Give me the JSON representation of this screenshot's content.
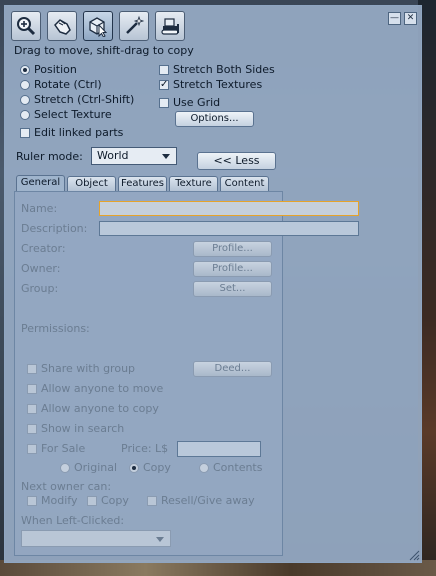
{
  "toolbar": {
    "tools": [
      {
        "name": "zoom",
        "icon": "magnifier-plus-icon"
      },
      {
        "name": "grab",
        "icon": "hand-icon"
      },
      {
        "name": "edit",
        "icon": "cube-cursor-icon"
      },
      {
        "name": "create",
        "icon": "magic-wand-icon"
      },
      {
        "name": "land",
        "icon": "bulldozer-icon"
      }
    ],
    "hint": "Drag to move, shift-drag to copy"
  },
  "window_buttons": {
    "minimize": "—",
    "close": "✕"
  },
  "edit_modes": [
    {
      "label": "Position",
      "selected": true
    },
    {
      "label": "Rotate (Ctrl)",
      "selected": false
    },
    {
      "label": "Stretch (Ctrl-Shift)",
      "selected": false
    },
    {
      "label": "Select Texture",
      "selected": false
    }
  ],
  "options": {
    "stretch_both_sides": {
      "label": "Stretch Both Sides",
      "checked": false
    },
    "stretch_textures": {
      "label": "Stretch Textures",
      "checked": true
    },
    "use_grid": {
      "label": "Use Grid",
      "checked": false
    },
    "options_button": "Options...",
    "edit_linked_parts": {
      "label": "Edit linked parts",
      "checked": false
    }
  },
  "ruler": {
    "label": "Ruler mode:",
    "value": "World"
  },
  "less_button": "<< Less",
  "tabs": [
    "General",
    "Object",
    "Features",
    "Texture",
    "Content"
  ],
  "active_tab": "General",
  "general": {
    "name_label": "Name:",
    "name_value": "",
    "description_label": "Description:",
    "description_value": "",
    "creator_label": "Creator:",
    "owner_label": "Owner:",
    "group_label": "Group:",
    "profile_button": "Profile...",
    "set_button": "Set...",
    "permissions_label": "Permissions:",
    "share_with_group": "Share with group",
    "deed_button": "Deed...",
    "allow_move": "Allow anyone to move",
    "allow_copy": "Allow anyone to copy",
    "show_in_search": "Show in search",
    "for_sale": "For Sale",
    "price_label": "Price:  L$",
    "price_value": "",
    "sale_types": [
      "Original",
      "Copy",
      "Contents"
    ],
    "sale_type_selected": "Copy",
    "next_owner_label": "Next owner can:",
    "next_owner_perms": [
      "Modify",
      "Copy",
      "Resell/Give away"
    ],
    "left_click_label": "When Left-Clicked:",
    "left_click_value": ""
  },
  "colors": {
    "panel_bg": "#96aac4",
    "accent_focus": "#e6a32a",
    "text": "#0d1a2a",
    "disabled_text": "#6b7d92"
  }
}
